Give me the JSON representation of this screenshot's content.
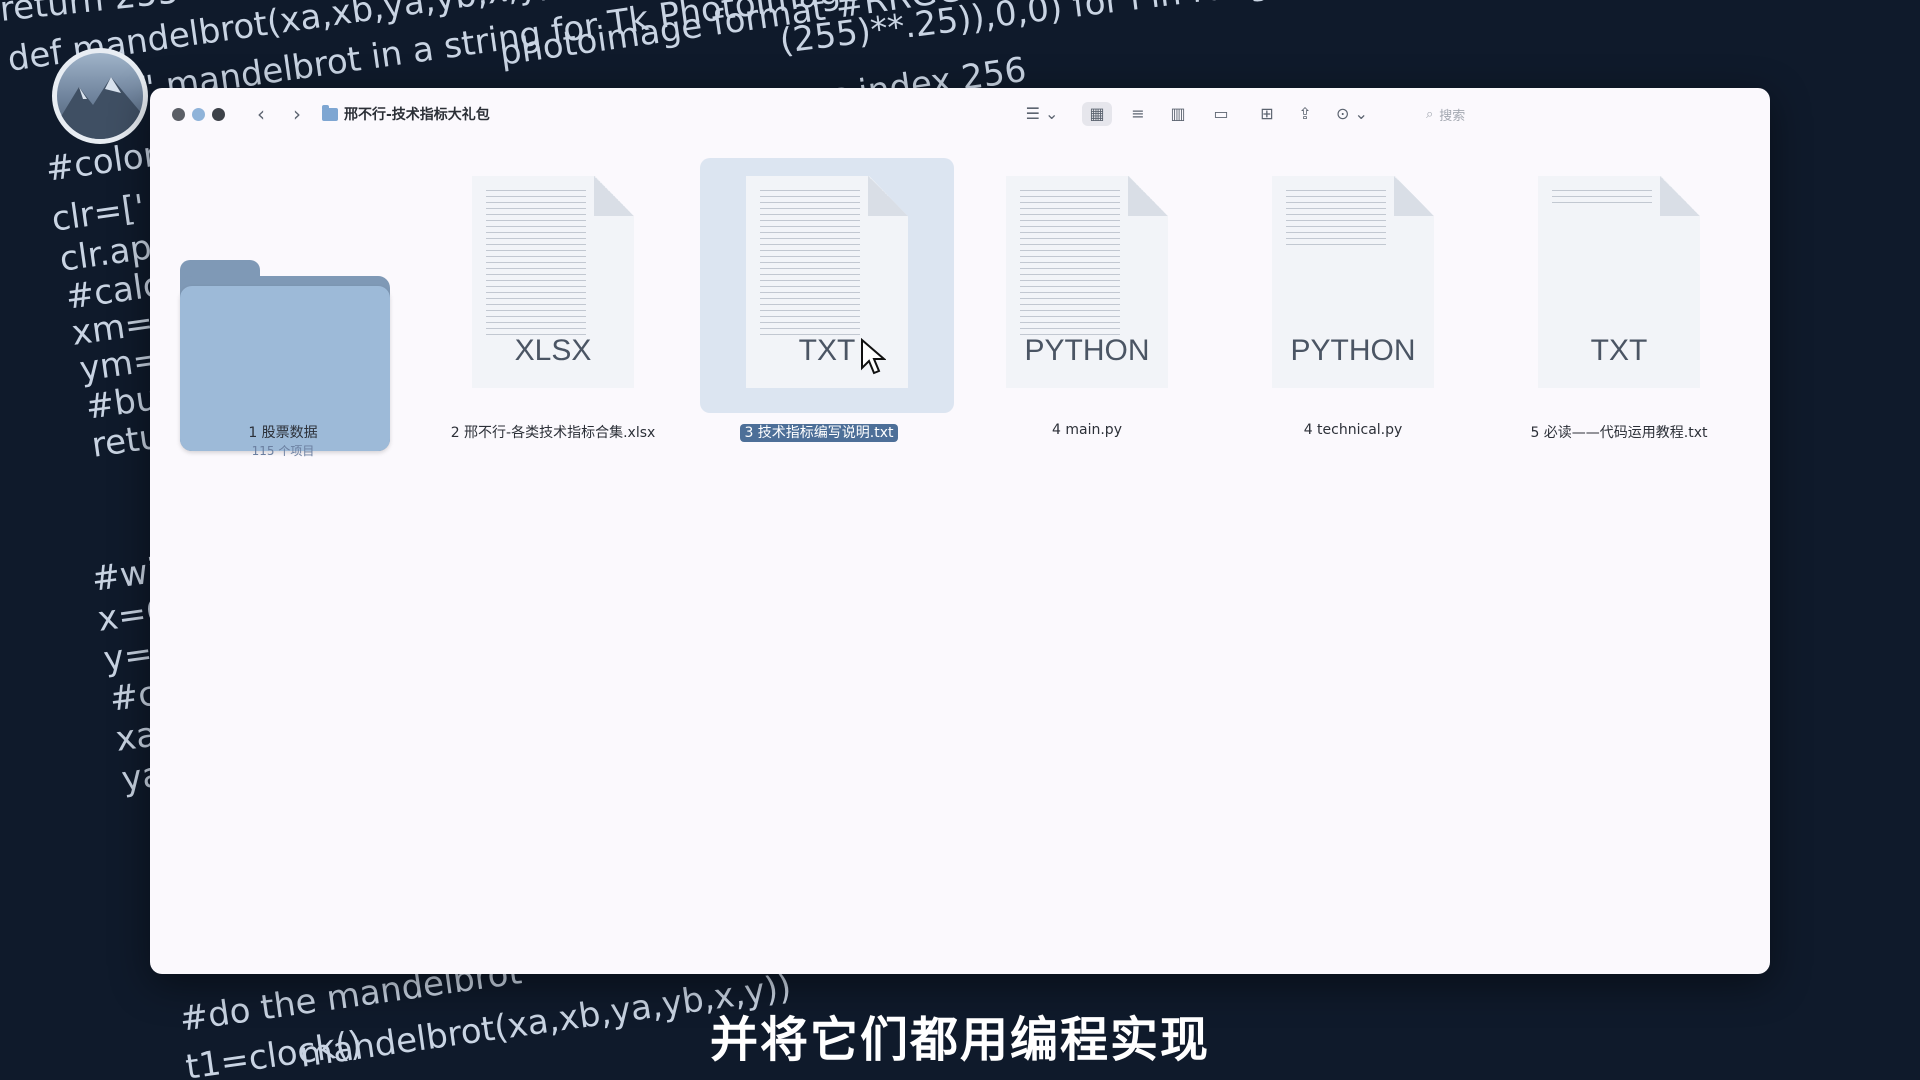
{
  "background_code": [
    "return 255",
    "def mandelbrot(xa,xb,ya,yb,x,y):",
    "\" mandelbrot in a string for Tk PhotoImage",
    "photoimage format #RRGGBB",
    "(255)**.25)),0,0) for i in range(256)]",
    "as index 256",
    "#color s",
    "clr=[' #",
    "clr.app",
    "#calcu",
    "xm=[x",
    "ym=[",
    "#bui",
    "retu",
    "#wi",
    "x=6",
    "y=4",
    "#c",
    "xa",
    "ya",
    "#do the mandelbrot",
    "t1=clock()",
    "mandelbrot(xa,xb,ya,yb,x,y))"
  ],
  "window": {
    "breadcrumb": "邢不行-技术指标大礼包",
    "search_placeholder": "搜索"
  },
  "items": [
    {
      "name": "1 股票数据",
      "sub": "115 个项目",
      "kind": "folder"
    },
    {
      "name": "2 邢不行-各类技术指标合集.xlsx",
      "kind": "doc",
      "ext": "XLSX"
    },
    {
      "name": "3 技术指标编写说明.txt",
      "kind": "doc",
      "ext": "TXT",
      "selected": true
    },
    {
      "name": "4 main.py",
      "kind": "doc",
      "ext": "PYTHON"
    },
    {
      "name": "4 technical.py",
      "kind": "doc",
      "ext": "PYTHON"
    },
    {
      "name": "5 必读——代码运用教程.txt",
      "kind": "doc",
      "ext": "TXT"
    }
  ],
  "subtitle": "并将它们都用编程实现",
  "colors": {
    "selection": "#4d6f98",
    "folder": "#9dbad8",
    "background": "#0f1a2b"
  }
}
